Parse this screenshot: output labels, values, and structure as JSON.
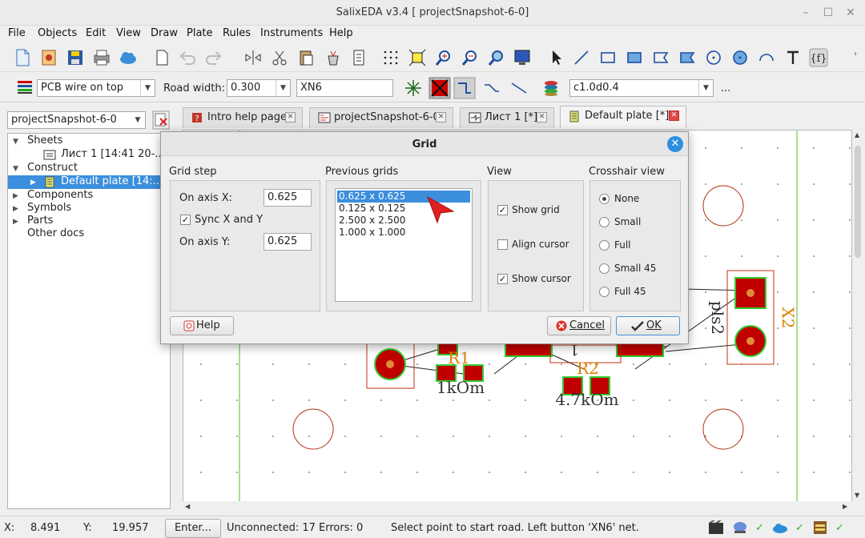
{
  "window": {
    "title": "SalixEDA v3.4 [ projectSnapshot-6-0]"
  },
  "menu": [
    "File",
    "Objects",
    "Edit",
    "View",
    "Draw",
    "Plate",
    "Rules",
    "Instruments",
    "Help"
  ],
  "toolbar2": {
    "layer_select": "PCB wire on top",
    "road_width_label": "Road width:",
    "road_width_value": "0.300",
    "net_value": "XN6",
    "rule_value": "c1.0d0.4",
    "more": "..."
  },
  "project_select": "projectSnapshot-6-0",
  "tree": {
    "sheets": "Sheets",
    "sheet1": "Лист 1 [14:41 20-...",
    "construct": "Construct",
    "default_plate": "Default plate [14:...",
    "components": "Components",
    "symbols": "Symbols",
    "parts": "Parts",
    "other_docs": "Other docs"
  },
  "tabs": [
    {
      "label": "Intro help page"
    },
    {
      "label": "projectSnapshot-6-0"
    },
    {
      "label": "Лист 1 [*]"
    },
    {
      "label": "Default plate [*]"
    }
  ],
  "pcb": {
    "r1_ref": "R1",
    "r1_value": "1kOm",
    "r2_ref": "R2",
    "r2_value": "4.7kOm",
    "x2_ref": "X2",
    "x2_value": "pls2",
    "partial_label": "1",
    "colors": {
      "pad": "#c00000",
      "pad_outline": "#33cc33",
      "silk": "#cc3300",
      "board_edge": "#66cc44",
      "label": "#e08000"
    }
  },
  "dialog": {
    "title": "Grid",
    "grid_step_label": "Grid step",
    "axis_x_label": "On axis X:",
    "axis_x_value": "0.625",
    "sync_label": "Sync X and Y",
    "sync_checked": true,
    "axis_y_label": "On axis Y:",
    "axis_y_value": "0.625",
    "previous_label": "Previous grids",
    "previous": [
      "0.625 x 0.625",
      "0.125 x 0.125",
      "2.500 x 2.500",
      "1.000 x 1.000"
    ],
    "selected_index": 0,
    "view_label": "View",
    "show_grid": "Show grid",
    "show_grid_checked": true,
    "align_cursor": "Align cursor",
    "align_cursor_checked": false,
    "show_cursor": "Show cursor",
    "show_cursor_checked": true,
    "crosshair_label": "Crosshair view",
    "crosshair_options": [
      "None",
      "Small",
      "Full",
      "Small 45",
      "Full 45"
    ],
    "crosshair_selected": 0,
    "help_button": "Help",
    "cancel_button": "Cancel",
    "ok_button": "OK"
  },
  "status": {
    "x_label": "X:",
    "x_value": "8.491",
    "y_label": "Y:",
    "y_value": "19.957",
    "enter_button": "Enter...",
    "unconnected": "Unconnected: 17  Errors: 0",
    "message": "Select point to start road. Left button 'XN6' net."
  }
}
